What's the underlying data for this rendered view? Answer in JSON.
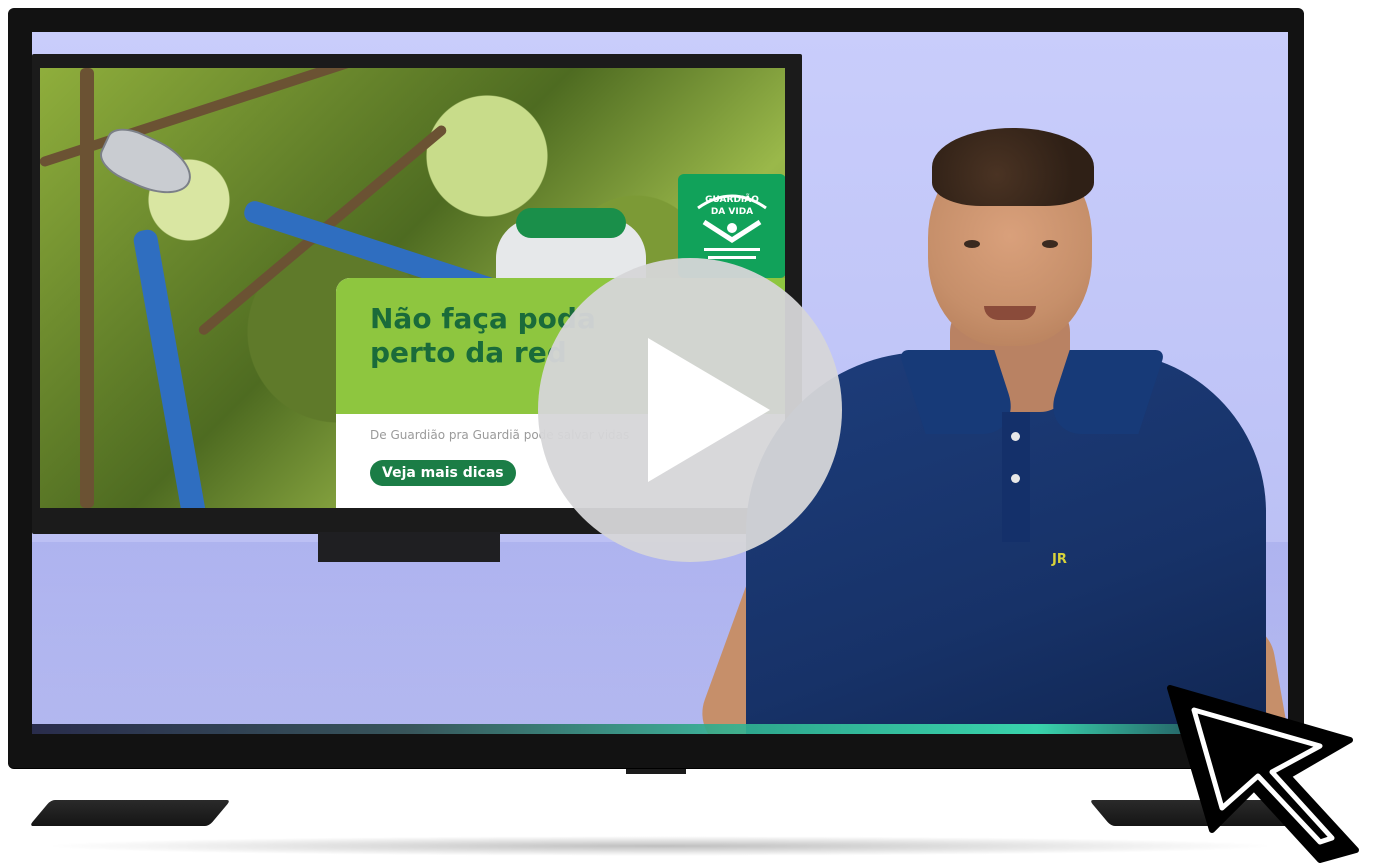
{
  "video": {
    "campaign": {
      "title": "Não faça poda\nperto da red",
      "subtitle": "De Guardião pra Guardiã                    pode salvar vidas",
      "cta_label": "Veja mais dicas",
      "logo_text_top": "GUARDIÃO",
      "logo_text_mid": "DA VIDA"
    },
    "presenter": {
      "shirt_logo": "JR"
    },
    "play_button_icon": "play-icon"
  },
  "overlay": {
    "cursor_icon": "mouse-pointer-icon"
  },
  "colors": {
    "campaign_green": "#8ec63f",
    "campaign_title": "#1a6b3a",
    "cta_green": "#1b7d46",
    "logo_green": "#11a25a",
    "shirt_navy": "#173268",
    "screen_bg": "#c3c7f8"
  }
}
